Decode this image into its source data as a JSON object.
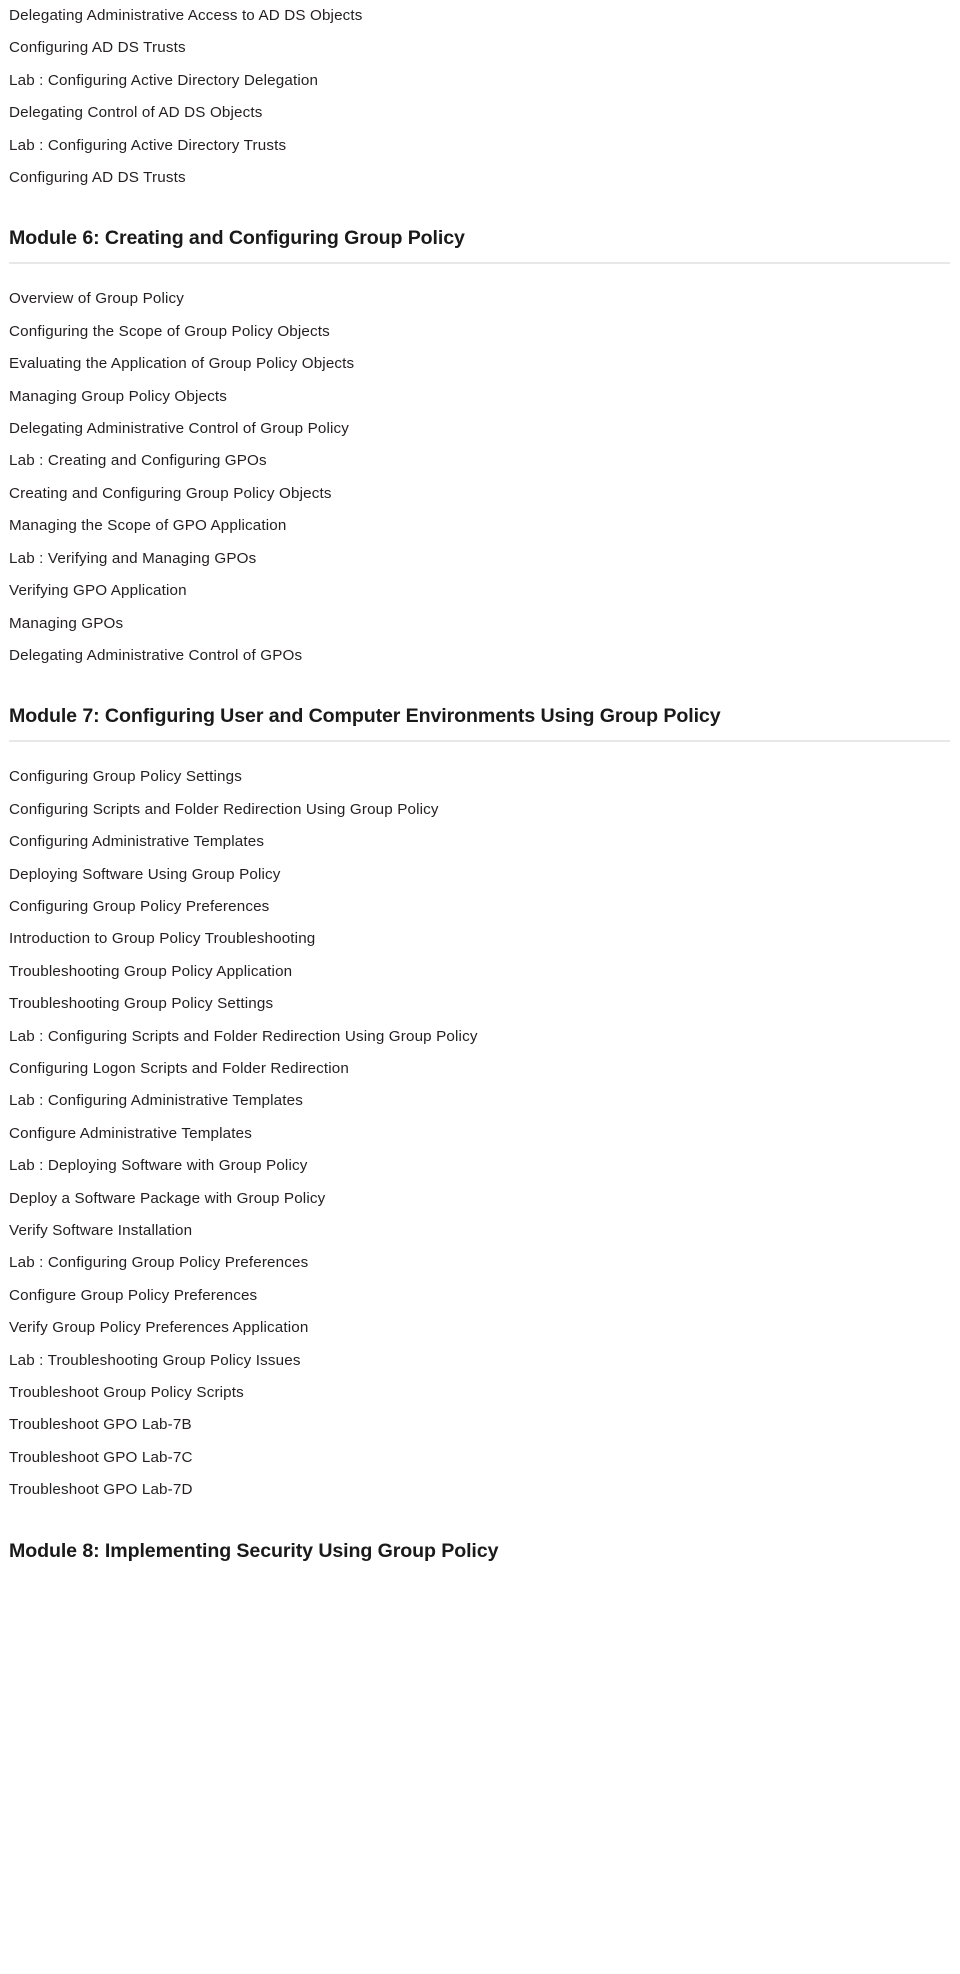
{
  "document": {
    "type": "course-outline",
    "intro_topics": [
      "Delegating Administrative Access to AD DS Objects",
      "Configuring AD DS Trusts",
      "Lab : Configuring Active Directory Delegation",
      "Delegating Control of AD DS Objects",
      "Lab : Configuring Active Directory Trusts",
      "Configuring AD DS Trusts"
    ],
    "modules": [
      {
        "heading": "Module 6: Creating and Configuring Group Policy",
        "topics": [
          "Overview of Group Policy",
          "Configuring the Scope of Group Policy Objects",
          "Evaluating the Application of Group Policy Objects",
          "Managing Group Policy Objects",
          "Delegating Administrative Control of Group Policy",
          "Lab : Creating and Configuring GPOs",
          "Creating and Configuring Group Policy Objects",
          "Managing the Scope of GPO Application",
          "Lab : Verifying and Managing GPOs",
          "Verifying GPO Application",
          "Managing GPOs",
          "Delegating Administrative Control of GPOs"
        ]
      },
      {
        "heading": "Module 7: Configuring User and Computer Environments Using Group Policy",
        "topics": [
          "Configuring Group Policy Settings",
          "Configuring Scripts and Folder Redirection Using Group Policy",
          "Configuring Administrative Templates",
          "Deploying Software Using Group Policy",
          "Configuring Group Policy Preferences",
          "Introduction to Group Policy Troubleshooting",
          "Troubleshooting Group Policy Application",
          "Troubleshooting Group Policy Settings",
          "Lab : Configuring Scripts and Folder Redirection Using Group Policy",
          "Configuring Logon Scripts and Folder Redirection",
          "Lab : Configuring Administrative Templates",
          "Configure Administrative Templates",
          "Lab : Deploying Software with Group Policy",
          "Deploy a Software Package with Group Policy",
          "Verify Software Installation",
          "Lab : Configuring Group Policy Preferences",
          "Configure Group Policy Preferences",
          "Verify Group Policy Preferences Application",
          "Lab : Troubleshooting Group Policy Issues",
          "Troubleshoot Group Policy Scripts",
          "Troubleshoot GPO Lab-7B",
          "Troubleshoot GPO Lab-7C",
          "Troubleshoot GPO Lab-7D"
        ]
      },
      {
        "heading": "Module 8: Implementing Security Using Group Policy",
        "topics": []
      }
    ]
  },
  "colors": {
    "text": "#231f20",
    "heading": "#1a1a1a",
    "rule": "#e8e8e8",
    "background": "#ffffff"
  }
}
